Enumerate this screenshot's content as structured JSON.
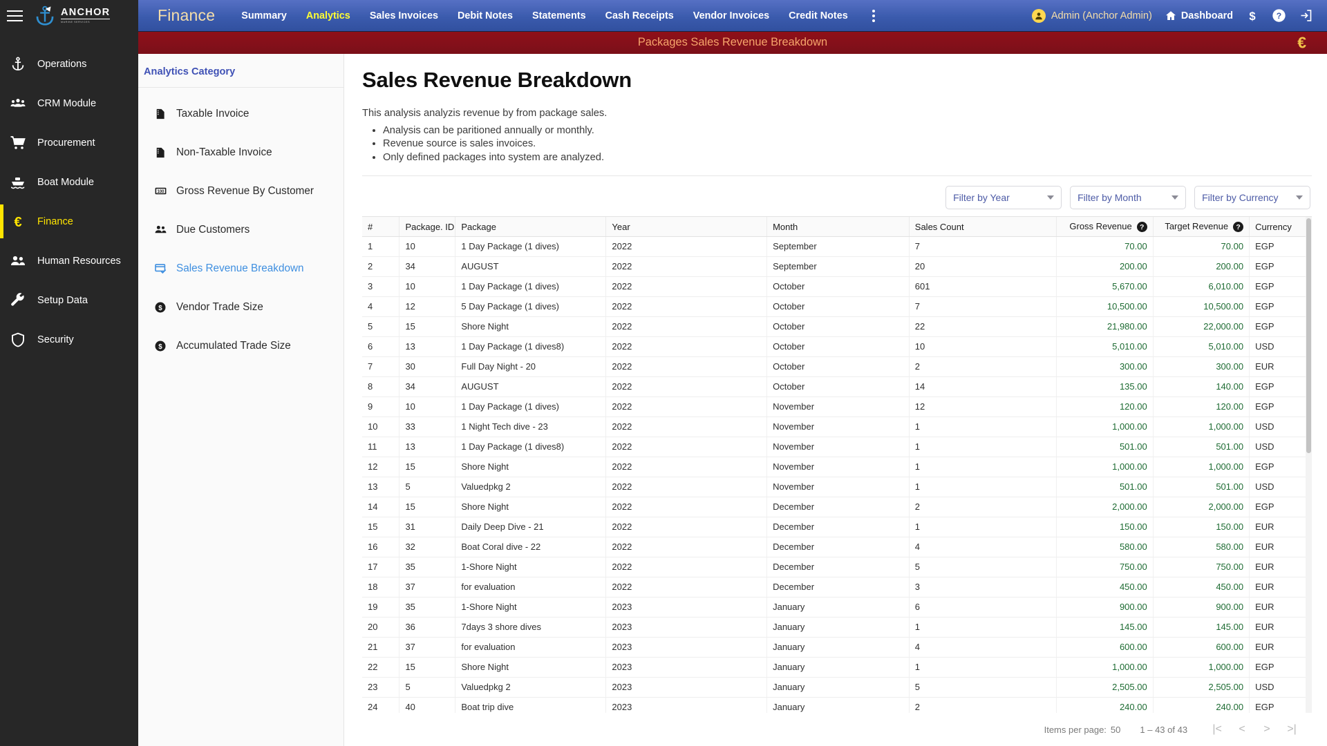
{
  "sidebar": {
    "brand": {
      "name": "ANCHOR",
      "sub": "MARINE SERVICES"
    },
    "items": [
      {
        "label": "Operations",
        "icon": "anchor-icon"
      },
      {
        "label": "CRM Module",
        "icon": "people-group-icon"
      },
      {
        "label": "Procurement",
        "icon": "shopping-cart-icon"
      },
      {
        "label": "Boat Module",
        "icon": "boat-icon"
      },
      {
        "label": "Finance",
        "icon": "euro-icon"
      },
      {
        "label": "Human Resources",
        "icon": "people-icon"
      },
      {
        "label": "Setup Data",
        "icon": "wrench-icon"
      },
      {
        "label": "Security",
        "icon": "shield-icon"
      }
    ]
  },
  "topbar": {
    "module_title": "Finance",
    "nav": [
      {
        "label": "Summary"
      },
      {
        "label": "Analytics"
      },
      {
        "label": "Sales Invoices"
      },
      {
        "label": "Debit Notes"
      },
      {
        "label": "Statements"
      },
      {
        "label": "Cash Receipts"
      },
      {
        "label": "Vendor Invoices"
      },
      {
        "label": "Credit Notes"
      }
    ],
    "user": "Admin (Anchor Admin)",
    "dashboard": "Dashboard",
    "currency_icon": "dollar-icon",
    "help_icon": "help-icon",
    "logout_icon": "logout-icon"
  },
  "banner": {
    "title": "Packages Sales Revenue Breakdown",
    "currency_symbol": "€"
  },
  "category_panel": {
    "title": "Analytics Category",
    "items": [
      {
        "label": "Taxable Invoice",
        "icon": "document-icon"
      },
      {
        "label": "Non-Taxable Invoice",
        "icon": "document-icon"
      },
      {
        "label": "Gross Revenue By Customer",
        "icon": "money-bill-icon"
      },
      {
        "label": "Due Customers",
        "icon": "people-icon"
      },
      {
        "label": "Sales Revenue Breakdown",
        "icon": "card-check-icon"
      },
      {
        "label": "Vendor Trade Size",
        "icon": "dollar-coin-icon"
      },
      {
        "label": "Accumulated Trade Size",
        "icon": "dollar-coin-icon"
      }
    ]
  },
  "main": {
    "page_title": "Sales Revenue Breakdown",
    "intro": "This analysis analyzis revenue by from package sales.",
    "bullets": [
      "Analysis can be paritioned annually or monthly.",
      "Revenue source is sales invoices.",
      "Only defined packages into system are analyzed."
    ],
    "filters": [
      {
        "label": "Filter by Year"
      },
      {
        "label": "Filter by Month"
      },
      {
        "label": "Filter by Currency"
      }
    ],
    "table": {
      "columns": [
        "#",
        "Package. ID",
        "Package",
        "Year",
        "Month",
        "Sales Count",
        "Gross Revenue",
        "Target Revenue",
        "Currency"
      ],
      "help_columns": [
        "Gross Revenue",
        "Target Revenue"
      ],
      "rows": [
        {
          "n": "1",
          "pkg_id": "10",
          "package": "1 Day Package (1 dives)",
          "year": "2022",
          "month": "September",
          "sales": "7",
          "gross": "70.00",
          "target": "70.00",
          "currency": "EGP"
        },
        {
          "n": "2",
          "pkg_id": "34",
          "package": "AUGUST",
          "year": "2022",
          "month": "September",
          "sales": "20",
          "gross": "200.00",
          "target": "200.00",
          "currency": "EGP"
        },
        {
          "n": "3",
          "pkg_id": "10",
          "package": "1 Day Package (1 dives)",
          "year": "2022",
          "month": "October",
          "sales": "601",
          "gross": "5,670.00",
          "target": "6,010.00",
          "currency": "EGP"
        },
        {
          "n": "4",
          "pkg_id": "12",
          "package": "5 Day Package (1 dives)",
          "year": "2022",
          "month": "October",
          "sales": "7",
          "gross": "10,500.00",
          "target": "10,500.00",
          "currency": "EGP"
        },
        {
          "n": "5",
          "pkg_id": "15",
          "package": "Shore Night",
          "year": "2022",
          "month": "October",
          "sales": "22",
          "gross": "21,980.00",
          "target": "22,000.00",
          "currency": "EGP"
        },
        {
          "n": "6",
          "pkg_id": "13",
          "package": "1 Day Package (1 dives8)",
          "year": "2022",
          "month": "October",
          "sales": "10",
          "gross": "5,010.00",
          "target": "5,010.00",
          "currency": "USD"
        },
        {
          "n": "7",
          "pkg_id": "30",
          "package": "Full Day Night - 20",
          "year": "2022",
          "month": "October",
          "sales": "2",
          "gross": "300.00",
          "target": "300.00",
          "currency": "EUR"
        },
        {
          "n": "8",
          "pkg_id": "34",
          "package": "AUGUST",
          "year": "2022",
          "month": "October",
          "sales": "14",
          "gross": "135.00",
          "target": "140.00",
          "currency": "EGP"
        },
        {
          "n": "9",
          "pkg_id": "10",
          "package": "1 Day Package (1 dives)",
          "year": "2022",
          "month": "November",
          "sales": "12",
          "gross": "120.00",
          "target": "120.00",
          "currency": "EGP"
        },
        {
          "n": "10",
          "pkg_id": "33",
          "package": "1 Night Tech dive - 23",
          "year": "2022",
          "month": "November",
          "sales": "1",
          "gross": "1,000.00",
          "target": "1,000.00",
          "currency": "USD"
        },
        {
          "n": "11",
          "pkg_id": "13",
          "package": "1 Day Package (1 dives8)",
          "year": "2022",
          "month": "November",
          "sales": "1",
          "gross": "501.00",
          "target": "501.00",
          "currency": "USD"
        },
        {
          "n": "12",
          "pkg_id": "15",
          "package": "Shore Night",
          "year": "2022",
          "month": "November",
          "sales": "1",
          "gross": "1,000.00",
          "target": "1,000.00",
          "currency": "EGP"
        },
        {
          "n": "13",
          "pkg_id": "5",
          "package": "Valuedpkg 2",
          "year": "2022",
          "month": "November",
          "sales": "1",
          "gross": "501.00",
          "target": "501.00",
          "currency": "USD"
        },
        {
          "n": "14",
          "pkg_id": "15",
          "package": "Shore Night",
          "year": "2022",
          "month": "December",
          "sales": "2",
          "gross": "2,000.00",
          "target": "2,000.00",
          "currency": "EGP"
        },
        {
          "n": "15",
          "pkg_id": "31",
          "package": "Daily Deep Dive - 21",
          "year": "2022",
          "month": "December",
          "sales": "1",
          "gross": "150.00",
          "target": "150.00",
          "currency": "EUR"
        },
        {
          "n": "16",
          "pkg_id": "32",
          "package": "Boat Coral dive - 22",
          "year": "2022",
          "month": "December",
          "sales": "4",
          "gross": "580.00",
          "target": "580.00",
          "currency": "EUR"
        },
        {
          "n": "17",
          "pkg_id": "35",
          "package": "1-Shore Night",
          "year": "2022",
          "month": "December",
          "sales": "5",
          "gross": "750.00",
          "target": "750.00",
          "currency": "EUR"
        },
        {
          "n": "18",
          "pkg_id": "37",
          "package": "for evaluation",
          "year": "2022",
          "month": "December",
          "sales": "3",
          "gross": "450.00",
          "target": "450.00",
          "currency": "EUR"
        },
        {
          "n": "19",
          "pkg_id": "35",
          "package": "1-Shore Night",
          "year": "2023",
          "month": "January",
          "sales": "6",
          "gross": "900.00",
          "target": "900.00",
          "currency": "EUR"
        },
        {
          "n": "20",
          "pkg_id": "36",
          "package": "7days 3 shore dives",
          "year": "2023",
          "month": "January",
          "sales": "1",
          "gross": "145.00",
          "target": "145.00",
          "currency": "EUR"
        },
        {
          "n": "21",
          "pkg_id": "37",
          "package": "for evaluation",
          "year": "2023",
          "month": "January",
          "sales": "4",
          "gross": "600.00",
          "target": "600.00",
          "currency": "EUR"
        },
        {
          "n": "22",
          "pkg_id": "15",
          "package": "Shore Night",
          "year": "2023",
          "month": "January",
          "sales": "1",
          "gross": "1,000.00",
          "target": "1,000.00",
          "currency": "EGP"
        },
        {
          "n": "23",
          "pkg_id": "5",
          "package": "Valuedpkg 2",
          "year": "2023",
          "month": "January",
          "sales": "5",
          "gross": "2,505.00",
          "target": "2,505.00",
          "currency": "USD"
        },
        {
          "n": "24",
          "pkg_id": "40",
          "package": "Boat trip dive",
          "year": "2023",
          "month": "January",
          "sales": "2",
          "gross": "240.00",
          "target": "240.00",
          "currency": "EGP"
        }
      ]
    },
    "paginator": {
      "items_per_page_label": "Items per page:",
      "items_per_page_value": "50",
      "range": "1 – 43 of 43",
      "first": "|<",
      "prev": "<",
      "next": ">",
      "last": ">|"
    }
  },
  "colors": {
    "accent_yellow": "#ffe400",
    "topbar_blue": "#3b5bad",
    "banner_red": "#83101a",
    "link_blue": "#3f8fe0",
    "money_green": "#1d6b32"
  }
}
